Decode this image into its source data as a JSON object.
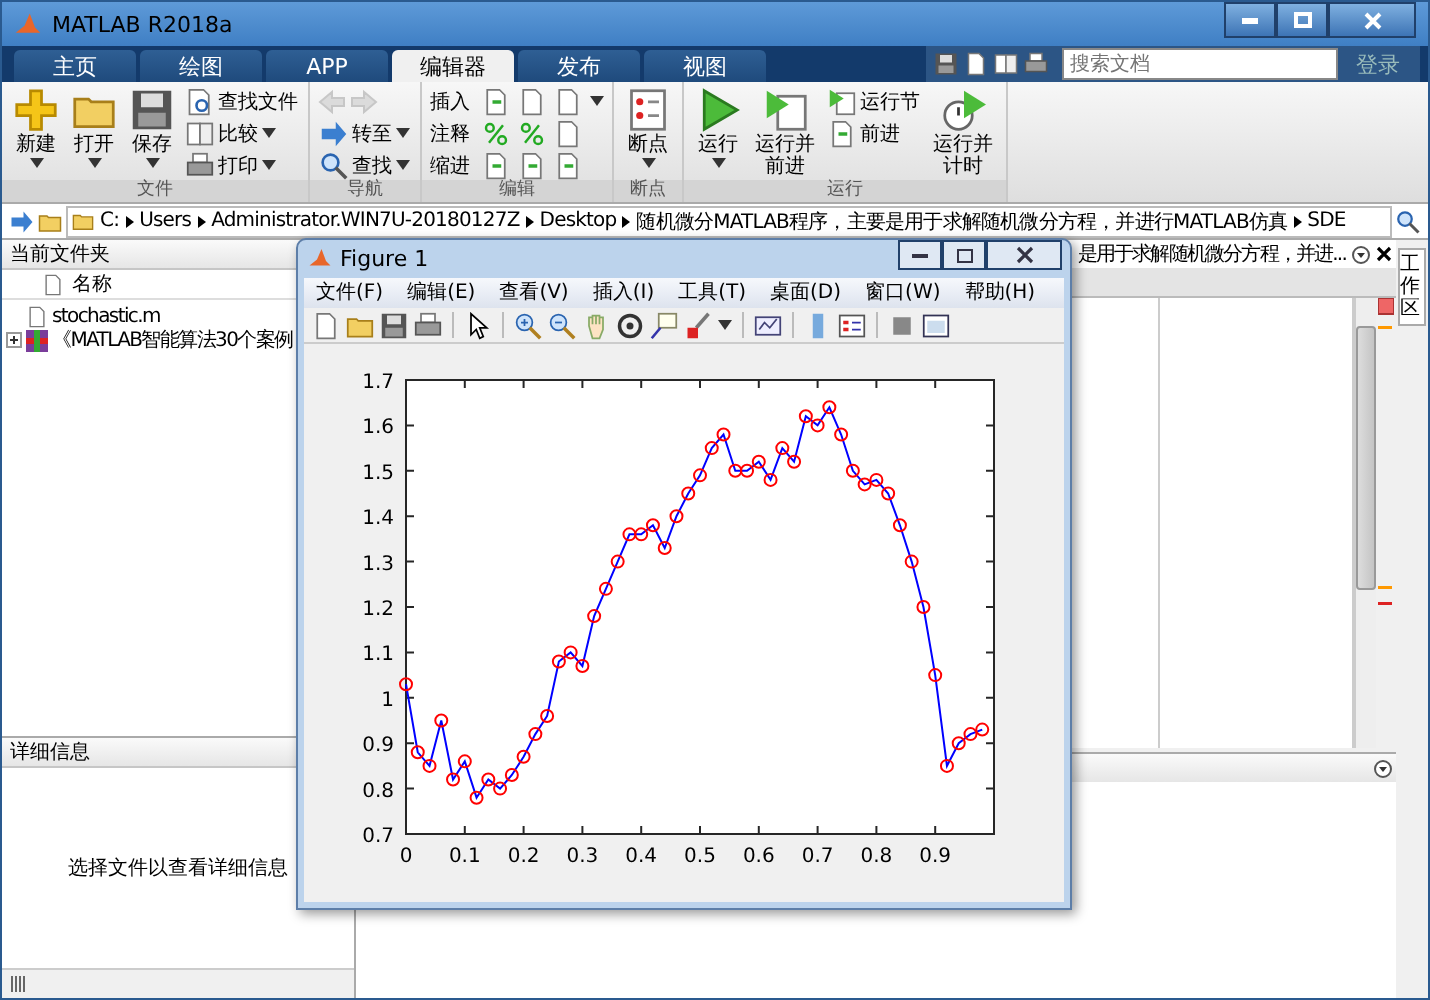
{
  "window": {
    "title": "MATLAB R2018a"
  },
  "tabs": [
    {
      "label": "主页",
      "selected": false
    },
    {
      "label": "绘图",
      "selected": false
    },
    {
      "label": "APP",
      "selected": false
    },
    {
      "label": "编辑器",
      "selected": true
    },
    {
      "label": "发布",
      "selected": false
    },
    {
      "label": "视图",
      "selected": false
    }
  ],
  "search": {
    "placeholder": "搜索文档"
  },
  "login_link": "登录",
  "ribbon_groups": [
    {
      "title": "文件",
      "items": [
        {
          "kind": "large",
          "label": "新建",
          "dropdown": true
        },
        {
          "kind": "large",
          "label": "打开",
          "dropdown": true
        },
        {
          "kind": "large",
          "label": "保存",
          "dropdown": true
        },
        {
          "kind": "column",
          "rows": [
            {
              "kind": "button",
              "label": "查找文件",
              "dropdown": false
            },
            {
              "kind": "button",
              "label": "比较",
              "dropdown": true
            },
            {
              "kind": "button",
              "label": "打印",
              "dropdown": true
            }
          ]
        }
      ]
    },
    {
      "title": "导航",
      "items": [
        {
          "kind": "column",
          "rows": [
            {
              "kind": "arrows",
              "disabled": true
            },
            {
              "kind": "button",
              "label": "转至",
              "dropdown": true
            },
            {
              "kind": "button",
              "label": "查找",
              "dropdown": true
            }
          ]
        }
      ]
    },
    {
      "title": "编辑",
      "items": [
        {
          "kind": "column",
          "rows": [
            {
              "kind": "icon_row",
              "label": "插入",
              "dropdown": true
            },
            {
              "kind": "icon_row",
              "label": "注释",
              "dropdown": false
            },
            {
              "kind": "icon_row",
              "label": "缩进",
              "dropdown": false
            }
          ]
        }
      ]
    },
    {
      "title": "断点",
      "items": [
        {
          "kind": "large",
          "label": "断点",
          "dropdown": true
        }
      ]
    },
    {
      "title": "运行",
      "items": [
        {
          "kind": "large",
          "label": "运行",
          "dropdown": true
        },
        {
          "kind": "large",
          "label": "运行并前进",
          "dropdown": false
        },
        {
          "kind": "column",
          "rows": [
            {
              "kind": "button",
              "label": "运行节",
              "dropdown": false
            },
            {
              "kind": "button",
              "label": "前进",
              "dropdown": false
            }
          ]
        },
        {
          "kind": "large",
          "label": "运行并计时",
          "dropdown": false
        }
      ]
    }
  ],
  "address_path": [
    "C:",
    "Users",
    "Administrator.WIN7U-20180127Z",
    "Desktop",
    "随机微分MATLAB程序，主要是用于求解随机微分方程，并进行MATLAB仿真",
    "SDE"
  ],
  "current_folder": {
    "title": "当前文件夹",
    "column": "名称",
    "files": [
      {
        "kind": "script",
        "name": "stochastic.m"
      },
      {
        "kind": "archive",
        "name": "《MATLAB智能算法30个案例"
      }
    ]
  },
  "details": {
    "title": "详细信息",
    "message": "选择文件以查看详细信息"
  },
  "editor": {
    "header": "是用于求解随机微分方程，并进..."
  },
  "workspace_tab": "工作区",
  "figure": {
    "title": "Figure 1",
    "menu": [
      "文件(F)",
      "编辑(E)",
      "查看(V)",
      "插入(I)",
      "工具(T)",
      "桌面(D)",
      "窗口(W)",
      "帮助(H)"
    ],
    "chart_data": {
      "type": "line",
      "x": [
        0,
        0.02,
        0.04,
        0.06,
        0.08,
        0.1,
        0.12,
        0.14,
        0.16,
        0.18,
        0.2,
        0.22,
        0.24,
        0.26,
        0.28,
        0.3,
        0.32,
        0.34,
        0.36,
        0.38,
        0.4,
        0.42,
        0.44,
        0.46,
        0.48,
        0.5,
        0.52,
        0.54,
        0.56,
        0.58,
        0.6,
        0.62,
        0.64,
        0.66,
        0.68,
        0.7,
        0.72,
        0.74,
        0.76,
        0.78,
        0.8,
        0.82,
        0.84,
        0.86,
        0.88,
        0.9,
        0.92,
        0.94,
        0.96,
        0.98
      ],
      "series": [
        {
          "color": "#0000ff",
          "marker": "o",
          "values": [
            1.03,
            0.88,
            0.85,
            0.95,
            0.82,
            0.86,
            0.78,
            0.82,
            0.8,
            0.83,
            0.87,
            0.92,
            0.96,
            1.08,
            1.1,
            1.07,
            1.18,
            1.24,
            1.3,
            1.36,
            1.36,
            1.38,
            1.33,
            1.4,
            1.45,
            1.49,
            1.55,
            1.58,
            1.5,
            1.5,
            1.52,
            1.48,
            1.55,
            1.52,
            1.62,
            1.6,
            1.64,
            1.58,
            1.5,
            1.47,
            1.48,
            1.45,
            1.38,
            1.3,
            1.2,
            1.05,
            0.85,
            0.9,
            0.92,
            0.93
          ]
        }
      ],
      "xlim": [
        0,
        1
      ],
      "ylim": [
        0.7,
        1.7
      ],
      "xticks": [
        0,
        0.1,
        0.2,
        0.3,
        0.4,
        0.5,
        0.6,
        0.7,
        0.8,
        0.9
      ],
      "yticks": [
        0.7,
        0.8,
        0.9,
        1,
        1.1,
        1.2,
        1.3,
        1.4,
        1.5,
        1.6,
        1.7
      ]
    }
  }
}
